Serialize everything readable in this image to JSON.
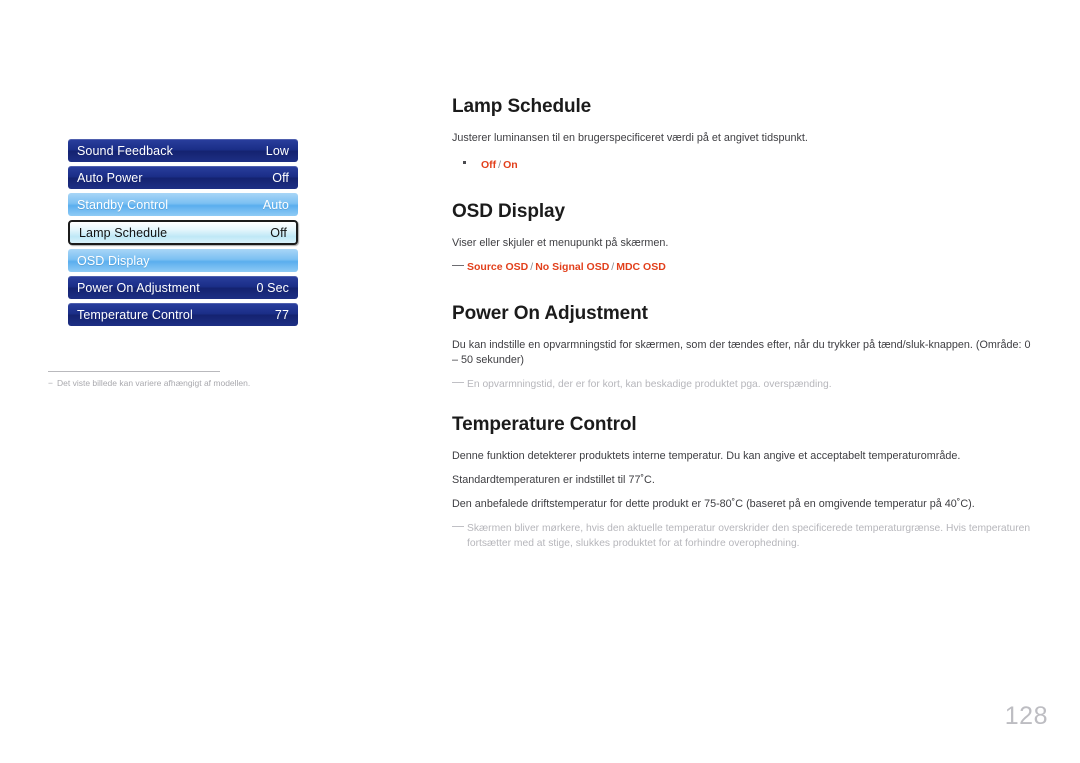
{
  "page": {
    "number": "128",
    "language": "da"
  },
  "osd": {
    "rows": [
      {
        "label": "Sound Feedback",
        "value": "Low",
        "style": "normal"
      },
      {
        "label": "Auto Power",
        "value": "Off",
        "style": "normal"
      },
      {
        "label": "Standby Control",
        "value": "Auto",
        "style": "light"
      },
      {
        "label": "Lamp Schedule",
        "value": "Off",
        "style": "selected"
      },
      {
        "label": "OSD Display",
        "value": "",
        "style": "light"
      },
      {
        "label": "Power On Adjustment",
        "value": "0 Sec",
        "style": "normal"
      },
      {
        "label": "Temperature Control",
        "value": "77",
        "style": "normal"
      }
    ],
    "image_note": "Det viste billede kan variere afhængigt af modellen."
  },
  "sections": {
    "lamp_schedule": {
      "title": "Lamp Schedule",
      "description": "Justerer luminansen til en brugerspecificeret værdi på et angivet tidspunkt.",
      "options": {
        "first": "Off",
        "separator": "/",
        "second": "On"
      }
    },
    "osd_display": {
      "title": "OSD Display",
      "description": "Viser eller skjuler et menupunkt på skærmen.",
      "options_note": {
        "item1": "Source OSD",
        "sep1": "/",
        "item2": "No Signal OSD",
        "sep2": "/",
        "item3": "MDC OSD"
      }
    },
    "power_on_adjustment": {
      "title": "Power On Adjustment",
      "description": "Du kan indstille en opvarmningstid for skærmen, som der tændes efter, når du trykker på tænd/sluk-knappen. (Område: 0 – 50 sekunder)",
      "note": "En opvarmningstid, der er for kort, kan beskadige produktet pga. overspænding."
    },
    "temperature_control": {
      "title": "Temperature Control",
      "description_1": "Denne funktion detekterer produktets interne temperatur. Du kan angive et acceptabelt temperaturområde.",
      "description_2": "Standardtemperaturen er indstillet til 77˚C.",
      "description_3": "Den anbefalede driftstemperatur for dette produkt er 75-80˚C (baseret på en omgivende temperatur på 40˚C).",
      "note": "Skærmen bliver mørkere, hvis den aktuelle temperatur overskrider den specificerede temperaturgrænse. Hvis temperaturen fortsætter med at stige, slukkes produktet for at forhindre overophedning."
    }
  },
  "colors": {
    "accent_red": "#e2401c",
    "osd_navy": "#1a2d86",
    "osd_light_blue": "#7cc0f2",
    "note_grey": "#b6b6bb"
  }
}
